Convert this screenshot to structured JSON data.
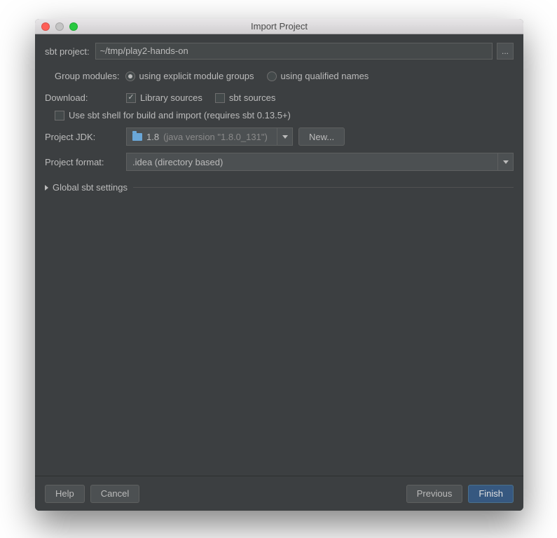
{
  "window": {
    "title": "Import Project"
  },
  "sbtProject": {
    "label": "sbt project:",
    "value": "~/tmp/play2-hands-on",
    "browse": "..."
  },
  "groupModules": {
    "label": "Group modules:",
    "opt1": "using explicit module groups",
    "opt2": "using qualified names"
  },
  "download": {
    "label": "Download:",
    "libSources": "Library sources",
    "sbtSources": "sbt sources"
  },
  "sbtShell": {
    "label": "Use sbt shell for build and import (requires sbt 0.13.5+)"
  },
  "projectJdk": {
    "label": "Project JDK:",
    "value": "1.8",
    "detail": "(java version \"1.8.0_131\")",
    "newBtn": "New..."
  },
  "projectFormat": {
    "label": "Project format:",
    "value": ".idea (directory based)"
  },
  "globalSettings": {
    "label": "Global sbt settings"
  },
  "footer": {
    "help": "Help",
    "cancel": "Cancel",
    "previous": "Previous",
    "finish": "Finish"
  }
}
